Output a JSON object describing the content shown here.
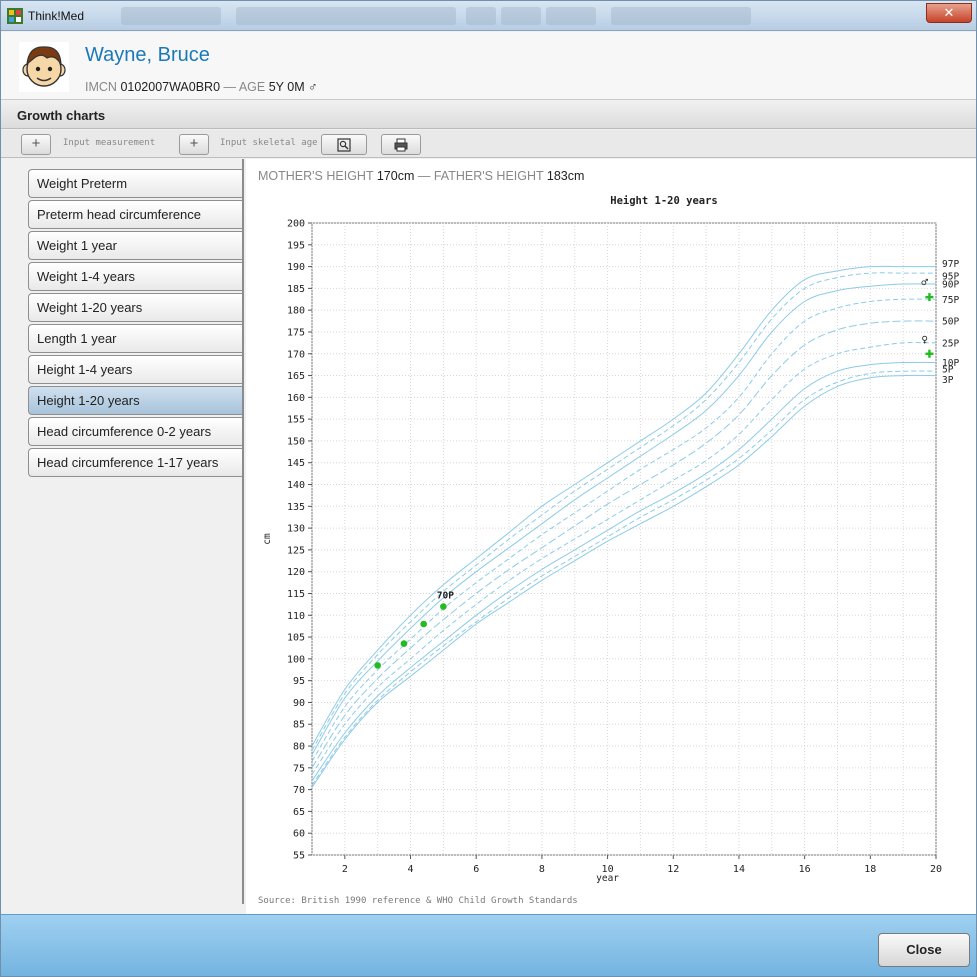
{
  "window": {
    "title": "Think!Med"
  },
  "patient": {
    "name": "Wayne, Bruce",
    "id_label": "IMCN",
    "id_value": "0102007WA0BR0",
    "separator": "—",
    "age_label": "AGE",
    "age_value": "5Y 0M",
    "sex_symbol": "♂"
  },
  "section": {
    "title": "Growth charts"
  },
  "toolbar": {
    "input_measurement_label": "Input measurement",
    "input_skeletal_age_label": "Input skeletal age",
    "add_icon": "plus-icon",
    "zoom_icon": "zoom-icon",
    "print_icon": "print-icon"
  },
  "sidebar": {
    "items": [
      {
        "label": "Weight Preterm"
      },
      {
        "label": "Preterm head circumference"
      },
      {
        "label": "Weight 1 year"
      },
      {
        "label": "Weight 1-4 years"
      },
      {
        "label": "Weight 1-20 years"
      },
      {
        "label": "Length 1 year"
      },
      {
        "label": "Height 1-4 years"
      },
      {
        "label": "Height 1-20 years"
      },
      {
        "label": "Head circumference 0-2 years"
      },
      {
        "label": "Head circumference 1-17 years"
      }
    ],
    "active_index": 7
  },
  "parents": {
    "mother_label": "MOTHER'S HEIGHT",
    "mother_value": "170cm",
    "separator": "—",
    "father_label": "FATHER'S HEIGHT",
    "father_value": "183cm"
  },
  "source_text": "Source: British 1990 reference & WHO Child Growth Standards",
  "footer": {
    "close_label": "Close"
  },
  "chart_data": {
    "type": "line",
    "title": "Height 1-20 years",
    "xlabel": "year",
    "ylabel": "cm",
    "xlim": [
      1,
      20
    ],
    "ylim": [
      55,
      200
    ],
    "x_ticks": [
      2,
      4,
      6,
      8,
      10,
      12,
      14,
      16,
      18,
      20
    ],
    "y_ticks": [
      55,
      60,
      65,
      70,
      75,
      80,
      85,
      90,
      95,
      100,
      105,
      110,
      115,
      120,
      125,
      130,
      135,
      140,
      145,
      150,
      155,
      160,
      165,
      170,
      175,
      180,
      185,
      190,
      195,
      200
    ],
    "grid": true,
    "percentile_x": [
      1,
      2,
      3,
      4,
      5,
      6,
      7,
      8,
      9,
      10,
      11,
      12,
      13,
      14,
      15,
      16,
      17,
      18,
      19,
      20
    ],
    "percentiles": [
      {
        "name": "97P",
        "values": [
          80,
          93,
          102,
          110,
          117,
          123,
          129,
          135,
          140,
          145,
          150,
          155,
          161,
          170,
          180,
          187,
          189,
          190,
          190,
          190
        ]
      },
      {
        "name": "95P",
        "values": [
          79,
          92,
          101,
          108.5,
          115.5,
          121.5,
          127.5,
          133,
          138.5,
          143.5,
          148.5,
          153.5,
          159.5,
          168,
          178,
          185,
          187.5,
          188.5,
          188.5,
          188.5
        ]
      },
      {
        "name": "90P",
        "values": [
          78,
          91,
          99.5,
          107,
          114,
          120,
          125.5,
          131,
          136.5,
          141.5,
          146.5,
          151.5,
          157,
          165,
          175,
          182,
          184.5,
          185.5,
          186,
          186
        ]
      },
      {
        "name": "75P",
        "values": [
          76.5,
          89,
          97.5,
          104.5,
          111.5,
          117.5,
          123,
          128.5,
          133.5,
          138.5,
          143.5,
          148,
          153,
          160,
          170,
          177.5,
          180.5,
          182,
          182.5,
          182.5
        ]
      },
      {
        "name": "50P",
        "values": [
          75,
          87,
          95.5,
          102.5,
          109,
          115,
          120.5,
          125.5,
          130.5,
          135.5,
          140,
          144.5,
          149.5,
          156,
          165,
          172,
          175.5,
          177,
          177.5,
          177.5
        ]
      },
      {
        "name": "25P",
        "values": [
          73.5,
          85,
          93.5,
          100,
          106.5,
          112.5,
          118,
          123,
          127.5,
          132,
          136.5,
          141,
          145.5,
          151.5,
          159.5,
          166.5,
          170,
          171.5,
          172.5,
          172.5
        ]
      },
      {
        "name": "10P",
        "values": [
          72,
          83,
          91.5,
          98,
          104,
          110,
          115.5,
          120.5,
          125,
          129.5,
          134,
          138,
          142.5,
          148,
          155,
          162,
          166,
          167.5,
          168,
          168
        ]
      },
      {
        "name": "5P",
        "values": [
          71,
          82,
          90.5,
          97,
          103,
          108.5,
          114,
          119,
          123.5,
          128,
          132.5,
          136.5,
          141,
          146,
          152.5,
          159.5,
          163.5,
          165.5,
          166,
          166
        ]
      },
      {
        "name": "3P",
        "values": [
          70.5,
          81.5,
          90,
          96,
          102,
          108,
          113,
          118,
          122.5,
          127,
          131,
          135,
          139.5,
          144.5,
          151,
          158,
          162.5,
          164.5,
          165,
          165
        ]
      }
    ],
    "measurements": {
      "x": [
        3,
        3.8,
        4.4,
        5
      ],
      "y": [
        98.5,
        103.5,
        108,
        112
      ]
    },
    "measurement_label": "70P",
    "father_marker": {
      "x": 19.8,
      "y": 183
    },
    "mother_marker": {
      "x": 19.8,
      "y": 170
    },
    "father_symbol": "♂",
    "mother_symbol": "♀",
    "colors": {
      "percentile_line": "#8ccbe8",
      "measurement": "#22bb22",
      "grid": "#d6d6d6",
      "axis": "#555555"
    }
  }
}
